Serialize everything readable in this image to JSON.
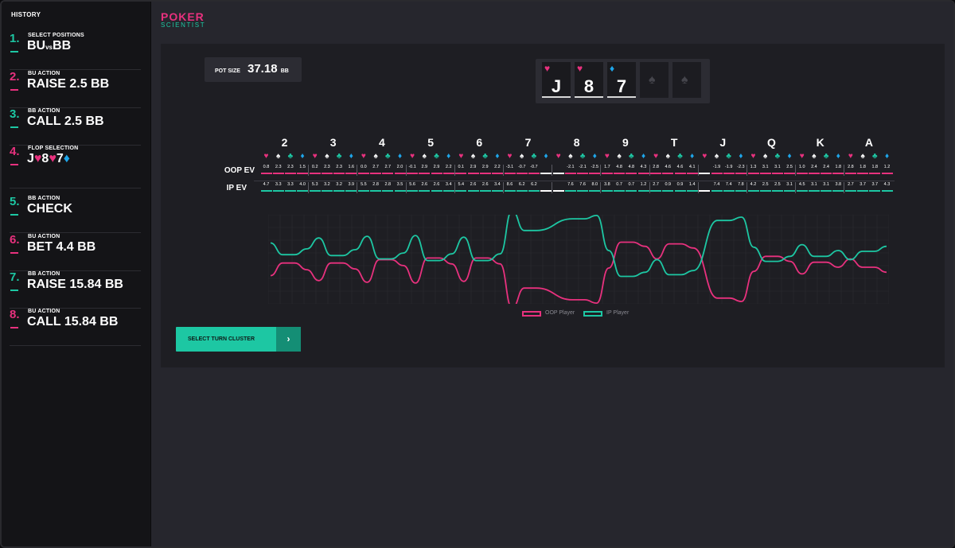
{
  "sidebar": {
    "title": "HISTORY",
    "steps": [
      {
        "num": "1.",
        "label": "SELECT POSITIONS",
        "value_a": "BU",
        "value_vs": "vs",
        "value_b": "BB",
        "color": "teal"
      },
      {
        "num": "2.",
        "label": "BU ACTION",
        "value": "RAISE 2.5 BB",
        "color": "pink"
      },
      {
        "num": "3.",
        "label": "BB ACTION",
        "value": "CALL 2.5 BB",
        "color": "teal"
      },
      {
        "num": "4.",
        "label": "FLOP SELECTION",
        "color": "pink",
        "cards": [
          {
            "rank": "J",
            "suit": "♥",
            "suit_color": "pink"
          },
          {
            "rank": "8",
            "suit": "♥",
            "suit_color": "pink"
          },
          {
            "rank": "7",
            "suit": "♦",
            "suit_color": "blue"
          }
        ]
      },
      {
        "num": "5.",
        "label": "BB ACTION",
        "value": "CHECK",
        "color": "teal"
      },
      {
        "num": "6.",
        "label": "BU ACTION",
        "value": "BET 4.4 BB",
        "color": "pink"
      },
      {
        "num": "7.",
        "label": "BB ACTION",
        "value": "RAISE 15.84 BB",
        "color": "teal"
      },
      {
        "num": "8.",
        "label": "BU ACTION",
        "value": "CALL 15.84 BB",
        "color": "pink"
      }
    ]
  },
  "logo": {
    "line1": "POKER",
    "line2": "SCIENTIST"
  },
  "pot": {
    "label": "POT SIZE",
    "value": "37.18",
    "unit": "BB"
  },
  "board": [
    {
      "rank": "J",
      "suit": "♥",
      "suit_color": "pink"
    },
    {
      "rank": "8",
      "suit": "♥",
      "suit_color": "pink"
    },
    {
      "rank": "7",
      "suit": "♦",
      "suit_color": "blue"
    },
    {
      "rank": "",
      "suit": "♠",
      "empty": true
    },
    {
      "rank": "",
      "suit": "♠",
      "empty": true
    }
  ],
  "table": {
    "row_labels": [
      "OOP EV",
      "IP EV"
    ],
    "suit_icons": [
      "♥",
      "♠",
      "♣",
      "♦"
    ],
    "ranks": [
      {
        "rank": "2",
        "oop": [
          "0.8",
          "2.3",
          "2.3",
          "1.5"
        ],
        "ip": [
          "4.7",
          "3.3",
          "3.3",
          "4.0"
        ]
      },
      {
        "rank": "3",
        "oop": [
          "0.2",
          "2.3",
          "2.3",
          "1.6"
        ],
        "ip": [
          "5.3",
          "3.2",
          "3.2",
          "3.9"
        ]
      },
      {
        "rank": "4",
        "oop": [
          "0.0",
          "2.7",
          "2.7",
          "2.0"
        ],
        "ip": [
          "5.5",
          "2.8",
          "2.8",
          "3.5"
        ]
      },
      {
        "rank": "5",
        "oop": [
          "-0.1",
          "2.9",
          "2.9",
          "2.2"
        ],
        "ip": [
          "5.6",
          "2.6",
          "2.6",
          "3.4"
        ]
      },
      {
        "rank": "6",
        "oop": [
          "0.1",
          "2.9",
          "2.9",
          "2.2"
        ],
        "ip": [
          "5.4",
          "2.6",
          "2.6",
          "3.4"
        ]
      },
      {
        "rank": "7",
        "oop": [
          "-3.1",
          "-0.7",
          "-0.7",
          ""
        ],
        "ip": [
          "8.6",
          "6.2",
          "6.2",
          ""
        ]
      },
      {
        "rank": "8",
        "oop": [
          "",
          "-2.1",
          "-2.1",
          "-2.5"
        ],
        "ip": [
          "",
          "7.6",
          "7.6",
          "8.0"
        ]
      },
      {
        "rank": "9",
        "oop": [
          "1.7",
          "4.8",
          "4.8",
          "4.3"
        ],
        "ip": [
          "3.8",
          "0.7",
          "0.7",
          "1.2"
        ]
      },
      {
        "rank": "T",
        "oop": [
          "2.8",
          "4.6",
          "4.6",
          "4.1"
        ],
        "ip": [
          "2.7",
          "0.9",
          "0.9",
          "1.4"
        ]
      },
      {
        "rank": "J",
        "oop": [
          "",
          "-1.9",
          "-1.9",
          "-2.3"
        ],
        "ip": [
          "",
          "7.4",
          "7.4",
          "7.8"
        ]
      },
      {
        "rank": "Q",
        "oop": [
          "1.3",
          "3.1",
          "3.1",
          "2.5"
        ],
        "ip": [
          "4.2",
          "2.5",
          "2.5",
          "3.1"
        ]
      },
      {
        "rank": "K",
        "oop": [
          "1.0",
          "2.4",
          "2.4",
          "1.8"
        ],
        "ip": [
          "4.5",
          "3.1",
          "3.1",
          "3.8"
        ]
      },
      {
        "rank": "A",
        "oop": [
          "2.8",
          "1.8",
          "1.8",
          "1.2"
        ],
        "ip": [
          "2.7",
          "3.7",
          "3.7",
          "4.3"
        ]
      }
    ]
  },
  "legend": {
    "oop": "OOP Player",
    "ip": "IP Player"
  },
  "button": {
    "label": "SELECT TURN CLUSTER",
    "arrow": "›"
  },
  "colors": {
    "pink": "#e8317e",
    "teal": "#1dc7a3",
    "blue": "#1ea6ea",
    "white": "#ffffff"
  }
}
